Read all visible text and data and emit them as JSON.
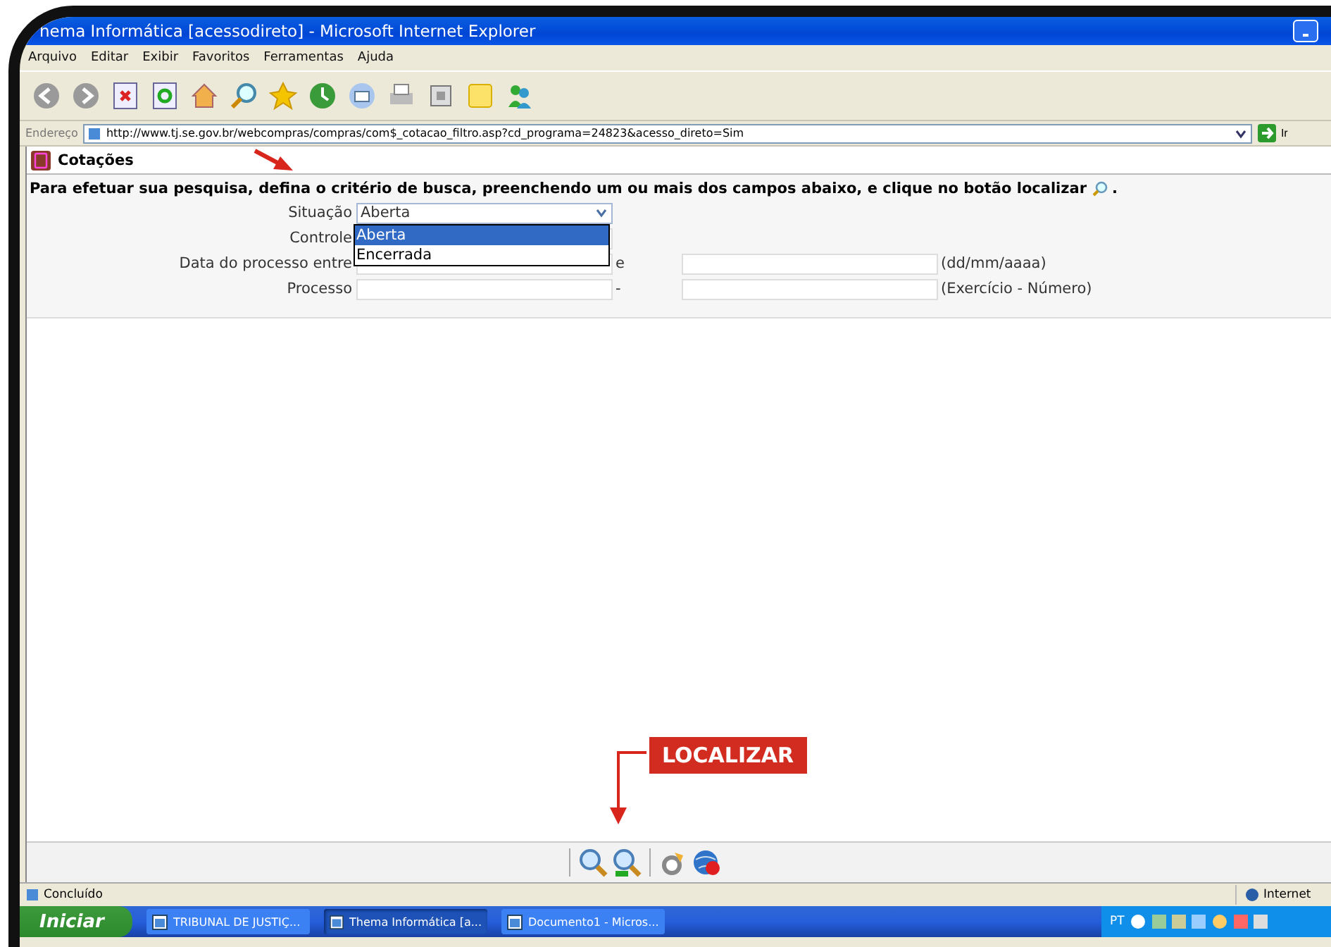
{
  "window": {
    "title": "hema Informática [acessodireto] - Microsoft Internet Explorer"
  },
  "menu": [
    "Arquivo",
    "Editar",
    "Exibir",
    "Favoritos",
    "Ferramentas",
    "Ajuda"
  ],
  "address_bar": {
    "label": "Endereço",
    "url": "http://www.tj.se.gov.br/webcompras/compras/com$_cotacao_filtro.asp?cd_programa=24823&acesso_direto=Sim",
    "go": "Ir"
  },
  "page": {
    "heading": "Cotações",
    "instruction": "Para efetuar sua pesquisa, defina o critério de busca, preenchendo um ou mais dos campos abaixo, e clique no botão localizar",
    "instruction_end": ".",
    "fields": [
      {
        "kind": "select",
        "label": "Situação",
        "value": "Aberta",
        "options": [
          {
            "label": "Aberta",
            "selected": true
          },
          {
            "label": "Encerrada",
            "selected": false
          }
        ]
      },
      {
        "kind": "text",
        "label": "Controle"
      },
      {
        "kind": "range",
        "label": "Data do processo entre",
        "separator": "e",
        "hint": "(dd/mm/aaaa)"
      },
      {
        "kind": "range",
        "label": "Processo",
        "separator": "-",
        "hint": "(Exercício - Número)"
      }
    ]
  },
  "callout": {
    "label": "LOCALIZAR"
  },
  "status_bar": {
    "status": "Concluído",
    "zone": "Internet"
  },
  "taskbar": {
    "start": "Iniciar",
    "tasks": [
      {
        "label": "TRIBUNAL DE JUSTIÇ...",
        "selected": false
      },
      {
        "label": "Thema Informática [a...",
        "selected": true
      },
      {
        "label": "Documento1 - Micros...",
        "selected": false
      }
    ],
    "language": "PT"
  }
}
